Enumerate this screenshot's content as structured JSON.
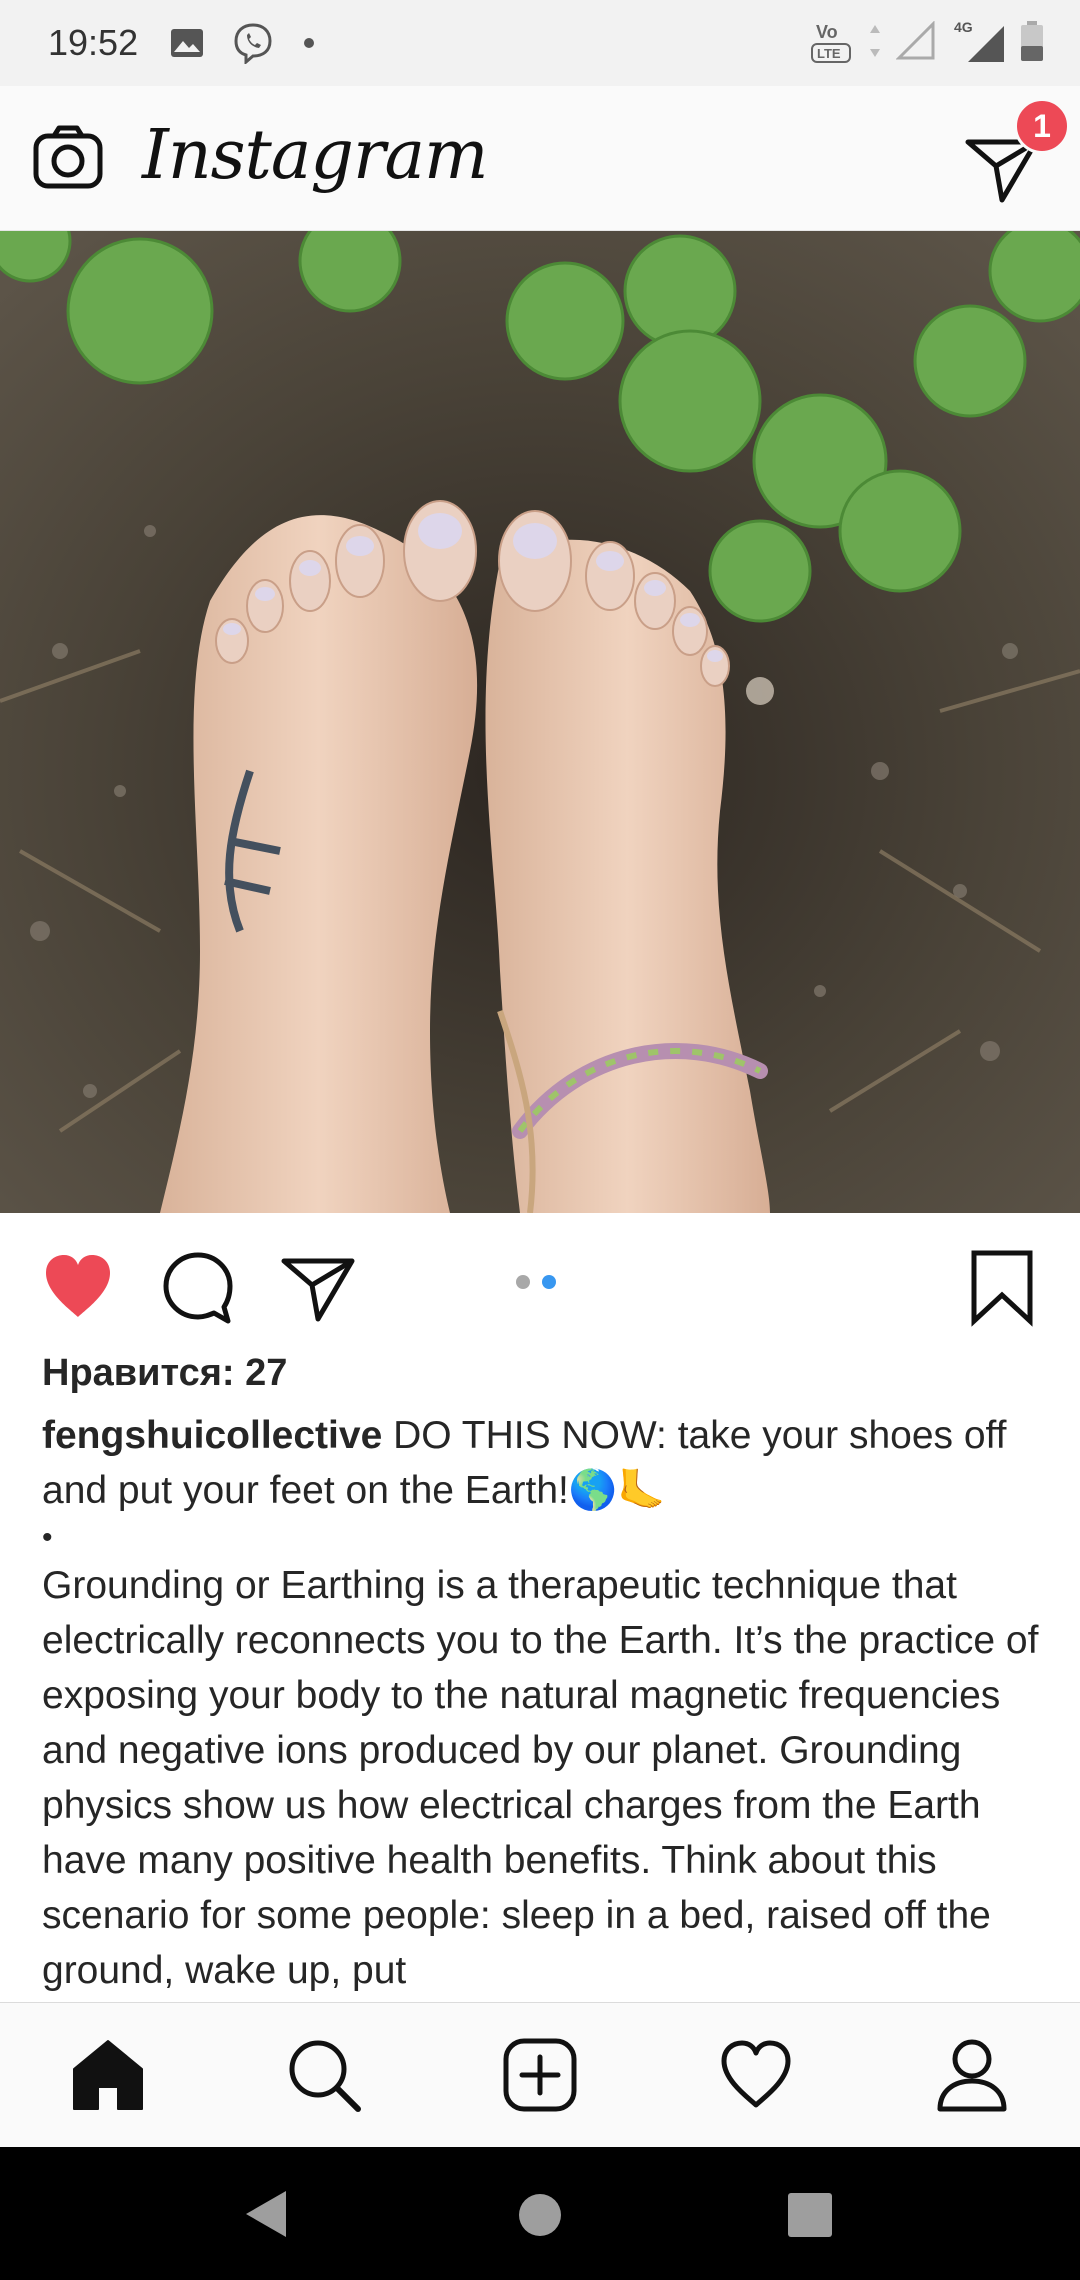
{
  "status_bar": {
    "time": "19:52",
    "left_icons": [
      "gallery-icon",
      "viber-icon",
      "notification-dot"
    ],
    "right_icons": [
      "volte-icon",
      "signal-icon",
      "4g-signal-icon",
      "battery-icon"
    ],
    "network": "4G",
    "volte": "VoLTE"
  },
  "app_bar": {
    "brand": "Instagram",
    "camera_icon": "camera-icon",
    "direct_icon": "direct-message-icon",
    "direct_badge": "1"
  },
  "post": {
    "image_alt": "photo",
    "carousel": {
      "count": 2,
      "active_index": 1
    },
    "actions": [
      "like-icon",
      "comment-icon",
      "share-icon",
      "save-icon"
    ],
    "liked": true,
    "likes_text": "Нравится: 27",
    "username": "fengshuicollective",
    "caption_first": "DO THIS NOW: take your shoes off and put your feet on the Earth!🌎🦶",
    "bullet": "•",
    "caption_body": "Grounding or Earthing is a therapeutic technique that electrically reconnects you to the Earth. It’s the practice of exposing your body to the natural magnetic frequencies and negative ions produced by our planet. Grounding physics show us how electrical charges from the Earth have many positive health benefits. Think about this scenario for some people: sleep in a bed, raised off the ground, wake up, put"
  },
  "bottom_nav": {
    "items": [
      "home-icon",
      "search-icon",
      "add-post-icon",
      "activity-icon",
      "profile-icon"
    ],
    "active": "home-icon"
  },
  "system_nav": [
    "back-button",
    "home-button",
    "recents-button"
  ],
  "colors": {
    "like_red": "#ed4956",
    "badge_red": "#ed4956",
    "carousel_blue": "#3897f0",
    "text": "#262626"
  }
}
